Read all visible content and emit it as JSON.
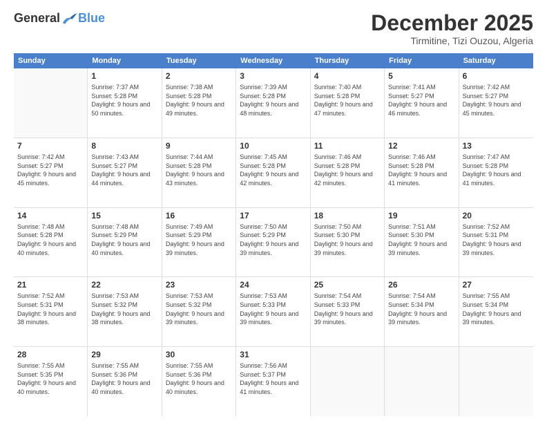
{
  "logo": {
    "general": "General",
    "blue": "Blue"
  },
  "title": {
    "month": "December 2025",
    "location": "Tirmitine, Tizi Ouzou, Algeria"
  },
  "weekdays": [
    "Sunday",
    "Monday",
    "Tuesday",
    "Wednesday",
    "Thursday",
    "Friday",
    "Saturday"
  ],
  "rows": [
    {
      "cells": [
        {
          "day": "",
          "empty": true
        },
        {
          "day": "1",
          "sunrise": "Sunrise: 7:37 AM",
          "sunset": "Sunset: 5:28 PM",
          "daylight": "Daylight: 9 hours and 50 minutes."
        },
        {
          "day": "2",
          "sunrise": "Sunrise: 7:38 AM",
          "sunset": "Sunset: 5:28 PM",
          "daylight": "Daylight: 9 hours and 49 minutes."
        },
        {
          "day": "3",
          "sunrise": "Sunrise: 7:39 AM",
          "sunset": "Sunset: 5:28 PM",
          "daylight": "Daylight: 9 hours and 48 minutes."
        },
        {
          "day": "4",
          "sunrise": "Sunrise: 7:40 AM",
          "sunset": "Sunset: 5:28 PM",
          "daylight": "Daylight: 9 hours and 47 minutes."
        },
        {
          "day": "5",
          "sunrise": "Sunrise: 7:41 AM",
          "sunset": "Sunset: 5:27 PM",
          "daylight": "Daylight: 9 hours and 46 minutes."
        },
        {
          "day": "6",
          "sunrise": "Sunrise: 7:42 AM",
          "sunset": "Sunset: 5:27 PM",
          "daylight": "Daylight: 9 hours and 45 minutes."
        }
      ]
    },
    {
      "cells": [
        {
          "day": "7",
          "sunrise": "Sunrise: 7:42 AM",
          "sunset": "Sunset: 5:27 PM",
          "daylight": "Daylight: 9 hours and 45 minutes."
        },
        {
          "day": "8",
          "sunrise": "Sunrise: 7:43 AM",
          "sunset": "Sunset: 5:27 PM",
          "daylight": "Daylight: 9 hours and 44 minutes."
        },
        {
          "day": "9",
          "sunrise": "Sunrise: 7:44 AM",
          "sunset": "Sunset: 5:28 PM",
          "daylight": "Daylight: 9 hours and 43 minutes."
        },
        {
          "day": "10",
          "sunrise": "Sunrise: 7:45 AM",
          "sunset": "Sunset: 5:28 PM",
          "daylight": "Daylight: 9 hours and 42 minutes."
        },
        {
          "day": "11",
          "sunrise": "Sunrise: 7:46 AM",
          "sunset": "Sunset: 5:28 PM",
          "daylight": "Daylight: 9 hours and 42 minutes."
        },
        {
          "day": "12",
          "sunrise": "Sunrise: 7:46 AM",
          "sunset": "Sunset: 5:28 PM",
          "daylight": "Daylight: 9 hours and 41 minutes."
        },
        {
          "day": "13",
          "sunrise": "Sunrise: 7:47 AM",
          "sunset": "Sunset: 5:28 PM",
          "daylight": "Daylight: 9 hours and 41 minutes."
        }
      ]
    },
    {
      "cells": [
        {
          "day": "14",
          "sunrise": "Sunrise: 7:48 AM",
          "sunset": "Sunset: 5:28 PM",
          "daylight": "Daylight: 9 hours and 40 minutes."
        },
        {
          "day": "15",
          "sunrise": "Sunrise: 7:48 AM",
          "sunset": "Sunset: 5:29 PM",
          "daylight": "Daylight: 9 hours and 40 minutes."
        },
        {
          "day": "16",
          "sunrise": "Sunrise: 7:49 AM",
          "sunset": "Sunset: 5:29 PM",
          "daylight": "Daylight: 9 hours and 39 minutes."
        },
        {
          "day": "17",
          "sunrise": "Sunrise: 7:50 AM",
          "sunset": "Sunset: 5:29 PM",
          "daylight": "Daylight: 9 hours and 39 minutes."
        },
        {
          "day": "18",
          "sunrise": "Sunrise: 7:50 AM",
          "sunset": "Sunset: 5:30 PM",
          "daylight": "Daylight: 9 hours and 39 minutes."
        },
        {
          "day": "19",
          "sunrise": "Sunrise: 7:51 AM",
          "sunset": "Sunset: 5:30 PM",
          "daylight": "Daylight: 9 hours and 39 minutes."
        },
        {
          "day": "20",
          "sunrise": "Sunrise: 7:52 AM",
          "sunset": "Sunset: 5:31 PM",
          "daylight": "Daylight: 9 hours and 39 minutes."
        }
      ]
    },
    {
      "cells": [
        {
          "day": "21",
          "sunrise": "Sunrise: 7:52 AM",
          "sunset": "Sunset: 5:31 PM",
          "daylight": "Daylight: 9 hours and 38 minutes."
        },
        {
          "day": "22",
          "sunrise": "Sunrise: 7:53 AM",
          "sunset": "Sunset: 5:32 PM",
          "daylight": "Daylight: 9 hours and 38 minutes."
        },
        {
          "day": "23",
          "sunrise": "Sunrise: 7:53 AM",
          "sunset": "Sunset: 5:32 PM",
          "daylight": "Daylight: 9 hours and 39 minutes."
        },
        {
          "day": "24",
          "sunrise": "Sunrise: 7:53 AM",
          "sunset": "Sunset: 5:33 PM",
          "daylight": "Daylight: 9 hours and 39 minutes."
        },
        {
          "day": "25",
          "sunrise": "Sunrise: 7:54 AM",
          "sunset": "Sunset: 5:33 PM",
          "daylight": "Daylight: 9 hours and 39 minutes."
        },
        {
          "day": "26",
          "sunrise": "Sunrise: 7:54 AM",
          "sunset": "Sunset: 5:34 PM",
          "daylight": "Daylight: 9 hours and 39 minutes."
        },
        {
          "day": "27",
          "sunrise": "Sunrise: 7:55 AM",
          "sunset": "Sunset: 5:34 PM",
          "daylight": "Daylight: 9 hours and 39 minutes."
        }
      ]
    },
    {
      "cells": [
        {
          "day": "28",
          "sunrise": "Sunrise: 7:55 AM",
          "sunset": "Sunset: 5:35 PM",
          "daylight": "Daylight: 9 hours and 40 minutes."
        },
        {
          "day": "29",
          "sunrise": "Sunrise: 7:55 AM",
          "sunset": "Sunset: 5:36 PM",
          "daylight": "Daylight: 9 hours and 40 minutes."
        },
        {
          "day": "30",
          "sunrise": "Sunrise: 7:55 AM",
          "sunset": "Sunset: 5:36 PM",
          "daylight": "Daylight: 9 hours and 40 minutes."
        },
        {
          "day": "31",
          "sunrise": "Sunrise: 7:56 AM",
          "sunset": "Sunset: 5:37 PM",
          "daylight": "Daylight: 9 hours and 41 minutes."
        },
        {
          "day": "",
          "empty": true
        },
        {
          "day": "",
          "empty": true
        },
        {
          "day": "",
          "empty": true
        }
      ]
    }
  ]
}
